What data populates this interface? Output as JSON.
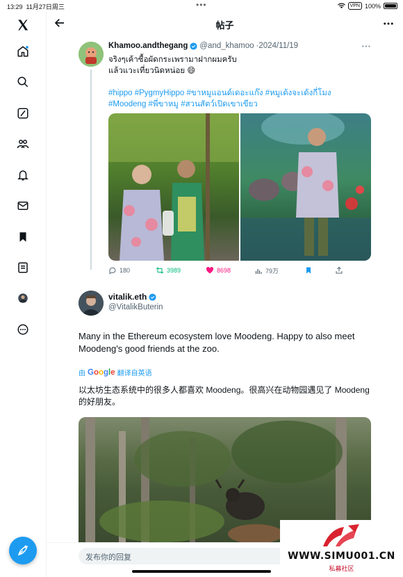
{
  "status_bar": {
    "time": "13:29",
    "date": "11月27日周三",
    "vpn": "VPN",
    "battery": "100%"
  },
  "header": {
    "title": "帖子"
  },
  "post1": {
    "name": "Khamoo.andthegang",
    "handle": "@and_khamoo",
    "date": "·2024/11/19",
    "text_line1": "จริงๆเค้าซื้อผัดกระเพรามาฝากผมครับ",
    "text_line2": "แล้วแวะเที่ยวนิดหน่อย 😄",
    "hashtags": "#hippo #PygmyHippo #ขาหมูแอนด์เดอะแก๊ง #หมูเด้งจะเด้งกี่โมง #Moodeng #พี่ขาหมู #สวนสัตว์เปิดเขาเขียว",
    "stats": {
      "replies": "180",
      "reposts": "3989",
      "likes": "8698",
      "views": "79万"
    }
  },
  "post2": {
    "name": "vitalik.eth",
    "handle": "@VitalikButerin",
    "text": "Many in the Ethereum ecosystem love Moodeng. Happy to also meet Moodeng's good friends at the zoo.",
    "translate_prefix": "由",
    "translate_brand": "Google",
    "translate_suffix": "翻译自英语",
    "text_zh": "以太坊生态系统中的很多人都喜欢 Moodeng。很高兴在动物园遇见了 Moodeng 的好朋友。"
  },
  "reply": {
    "placeholder": "发布你的回复"
  },
  "watermark": {
    "text": "WWW.SIMU001.CN",
    "sub": "私募社区"
  },
  "colors": {
    "accent": "#1d9bf0",
    "like": "#f91880",
    "repost": "#00ba7c"
  }
}
